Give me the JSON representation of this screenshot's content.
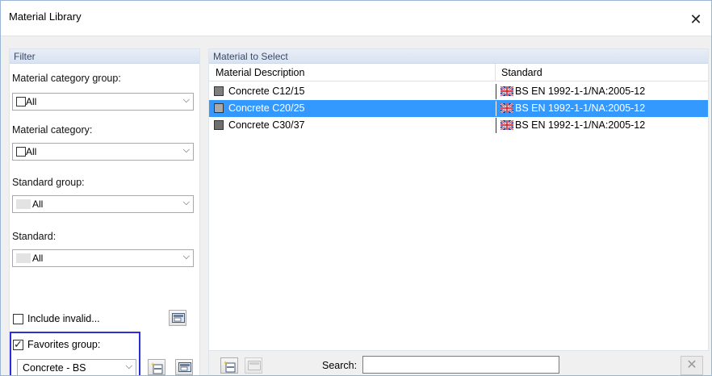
{
  "window": {
    "title": "Material Library",
    "close_glyph": "✕"
  },
  "filter": {
    "header": "Filter",
    "category_group": {
      "label": "Material category group:",
      "value": "All"
    },
    "category": {
      "label": "Material category:",
      "value": "All"
    },
    "standard_group": {
      "label": "Standard group:",
      "value": "All"
    },
    "standard": {
      "label": "Standard:",
      "value": "All"
    },
    "include_invalid": {
      "label": "Include invalid...",
      "checked": false
    },
    "favorites": {
      "label": "Favorites group:",
      "checked": true,
      "value": "Concrete - BS"
    }
  },
  "materials": {
    "header": "Material to Select",
    "columns": {
      "description": "Material Description",
      "standard": "Standard"
    },
    "rows": [
      {
        "description": "Concrete C12/15",
        "standard": "BS EN 1992-1-1/NA:2005-12",
        "swatch": "#7f7f7f",
        "selected": false
      },
      {
        "description": "Concrete C20/25",
        "standard": "BS EN 1992-1-1/NA:2005-12",
        "swatch": "#a9a9a9",
        "selected": true
      },
      {
        "description": "Concrete C30/37",
        "standard": "BS EN 1992-1-1/NA:2005-12",
        "swatch": "#6f6f6f",
        "selected": false
      }
    ]
  },
  "search": {
    "label": "Search:",
    "value": ""
  },
  "icons": [
    "close-icon",
    "chevron-down-icon",
    "filter-settings-icon",
    "new-favorite-icon",
    "edit-favorite-icon",
    "add-icon",
    "edit-icon",
    "clear-icon",
    "uk-flag-icon"
  ],
  "colors": {
    "selection": "#3399ff",
    "favorites_highlight": "#2d2de0"
  }
}
